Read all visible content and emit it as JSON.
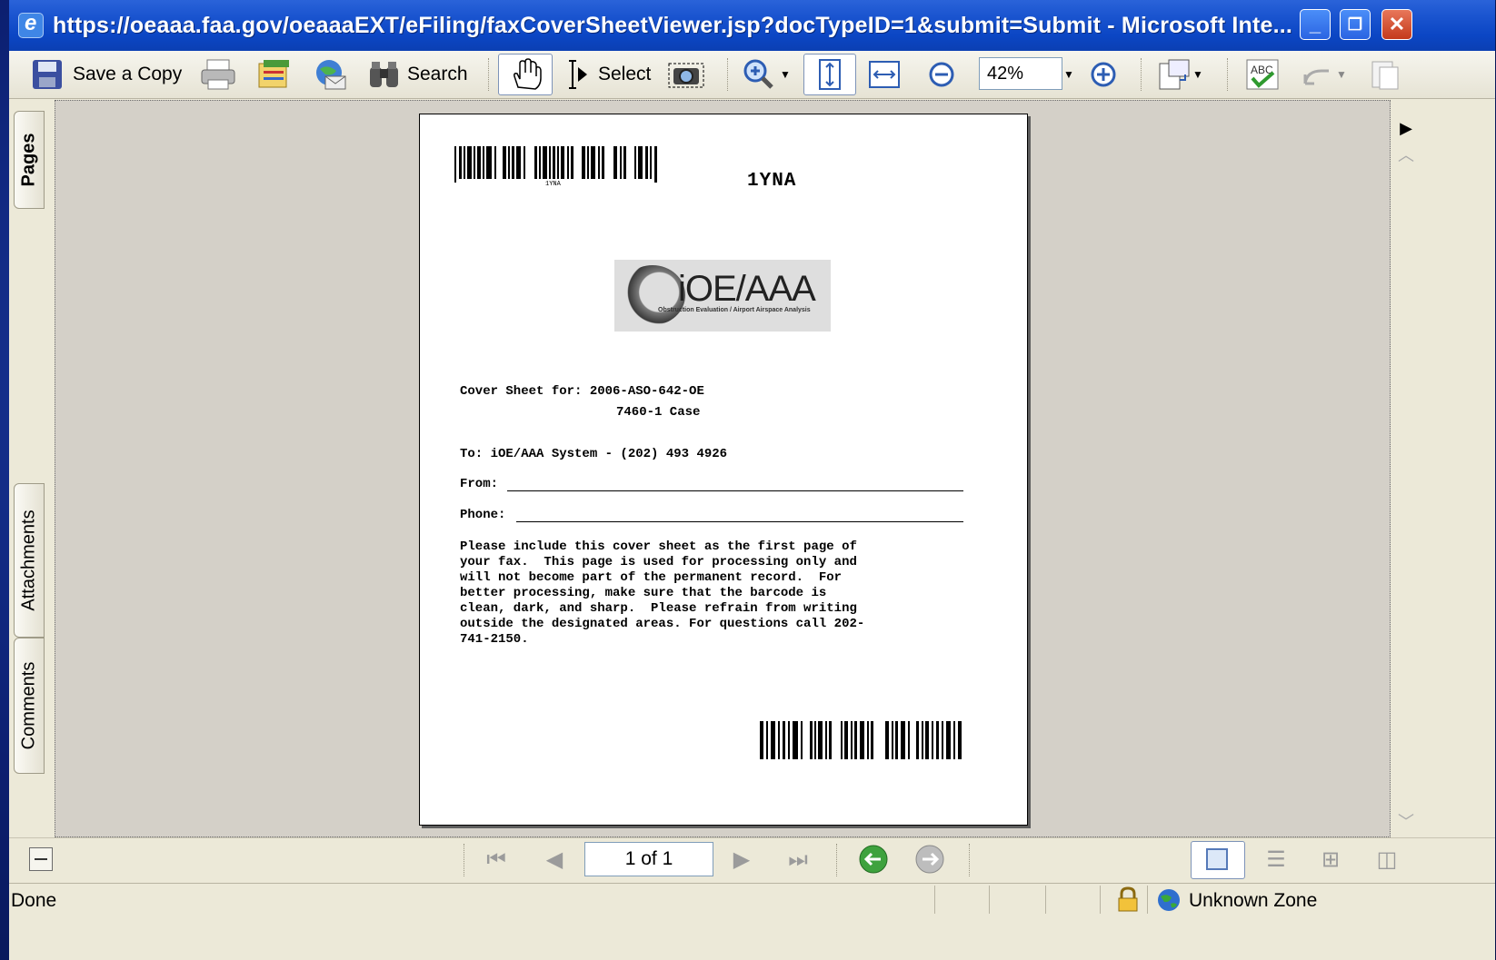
{
  "window": {
    "title": "https://oeaaa.faa.gov/oeaaaEXT/eFiling/faxCoverSheetViewer.jsp?docTypeID=1&submit=Submit - Microsoft Inte..."
  },
  "toolbar": {
    "save_copy": "Save a Copy",
    "search": "Search",
    "select": "Select",
    "zoom": "42%"
  },
  "sidebar": {
    "tabs": [
      "Pages",
      "Attachments",
      "Comments"
    ]
  },
  "document": {
    "barcode_top_label": "1YNA",
    "barcode_small_text": "1YNA",
    "logo_text": "iOE/AAA",
    "logo_subtext": "Obstruction Evaluation / Airport Airspace Analysis",
    "cover_for": "Cover Sheet for: 2006-ASO-642-OE",
    "case_type": "7460-1 Case",
    "to": "To: iOE/AAA System - (202) 493 4926",
    "from_label": "From:",
    "phone_label": "Phone:",
    "instructions": "Please include this cover sheet as the first page of\nyour fax.  This page is used for processing only and\nwill not become part of the permanent record.  For\nbetter processing, make sure that the barcode is\nclean, dark, and sharp.  Please refrain from writing\noutside the designated areas. For questions call 202-\n741-2150."
  },
  "navigation": {
    "page_indicator": "1 of 1"
  },
  "status": {
    "left": "Done",
    "zone": "Unknown Zone"
  }
}
